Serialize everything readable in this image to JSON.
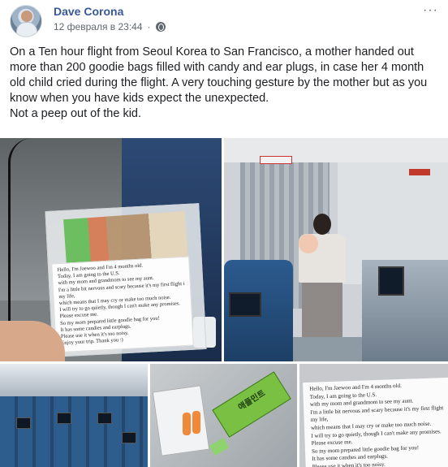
{
  "post": {
    "author": "Dave Corona",
    "timestamp": "12 февраля в 23:44",
    "more_label": "···",
    "text": "On a Ten hour flight from Seoul Korea to San Francisco, a mother handed out more than 200 goodie bags filled with candy and ear plugs, in case her 4 month old child cried during the flight. A very touching gesture by the mother but as you know when you have kids expect the unexpected.\nNot a peep out of the kid."
  },
  "note": {
    "lines": [
      "Hello, I'm Jaewoo and I'm 4 months old.",
      "Today, I am going to the U.S.",
      "with my mom and grandmom to see my aunt.",
      "I'm a little bit nervous and scary because it's my first flight in",
      "my life,",
      "which means that I may cry or make too much noise.",
      "I will try to go quietly, though I can't make any promises.",
      "Please excuse me.",
      "So my mom prepared little goodie bag for you!",
      "It has some candies and earplugs.",
      "Please use it when it's too noisy.",
      "Enjoy your trip. Thank you :)"
    ]
  },
  "photo4": {
    "gum_label": "애플민트"
  }
}
